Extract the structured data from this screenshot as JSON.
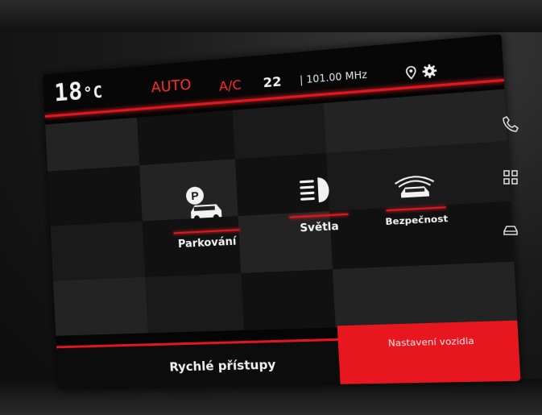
{
  "status_bar": {
    "temperature": "18",
    "temperature_unit": "°C",
    "climate_mode": "AUTO",
    "ac_label": "A/C",
    "fan_value": "22",
    "radio_frequency": "101.00 MHz"
  },
  "menu": {
    "items": [
      {
        "label": "Parkování",
        "icon": "parking-car-icon"
      },
      {
        "label": "Světla",
        "icon": "headlight-icon"
      },
      {
        "label": "Bezpečnost",
        "icon": "car-safety-icon"
      }
    ]
  },
  "tabs": {
    "quick_access": "Rychlé přístupy",
    "vehicle_settings": "Nastavení vozidla"
  },
  "side_keys": [
    "phone-icon",
    "apps-grid-icon",
    "car-icon"
  ],
  "colors": {
    "accent": "#e3151f",
    "text": "#f2f2f2",
    "background": "#050505"
  }
}
